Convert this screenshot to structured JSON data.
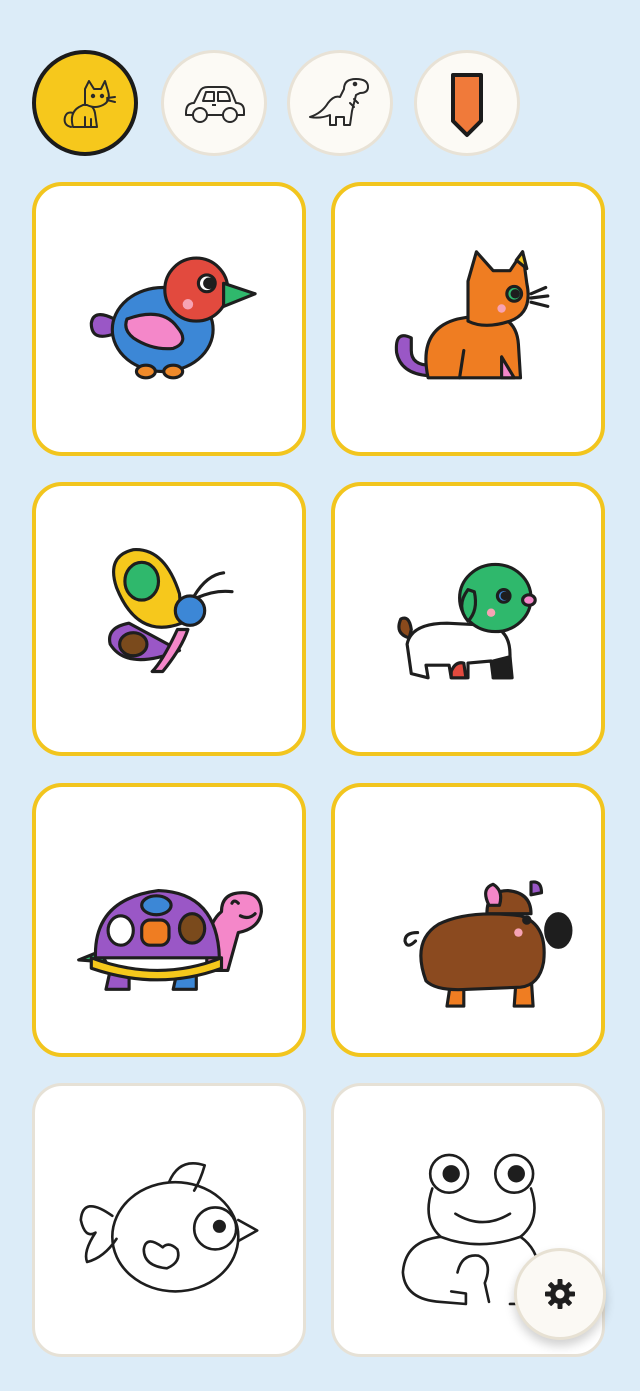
{
  "categories": [
    {
      "name": "cat-category-tab",
      "icon": "cat-icon",
      "selected": true
    },
    {
      "name": "car-category-tab",
      "icon": "car-icon",
      "selected": false
    },
    {
      "name": "dinosaur-category-tab",
      "icon": "dinosaur-icon",
      "selected": false
    },
    {
      "name": "bookmark-category-tab",
      "icon": "bookmark-icon",
      "selected": false
    }
  ],
  "pictures": [
    {
      "subject": "bird",
      "colored": true
    },
    {
      "subject": "cat",
      "colored": true
    },
    {
      "subject": "butterfly",
      "colored": true
    },
    {
      "subject": "puppy",
      "colored": true
    },
    {
      "subject": "turtle",
      "colored": true
    },
    {
      "subject": "pig",
      "colored": true
    },
    {
      "subject": "fish",
      "colored": false
    },
    {
      "subject": "frog",
      "colored": false
    }
  ],
  "colors": {
    "background": "#dcecf8",
    "active_tab": "#f6c81c",
    "painted_card_border": "#f2c51e",
    "bookmark": "#f07a3a"
  },
  "settings": {
    "icon": "gear-icon"
  }
}
